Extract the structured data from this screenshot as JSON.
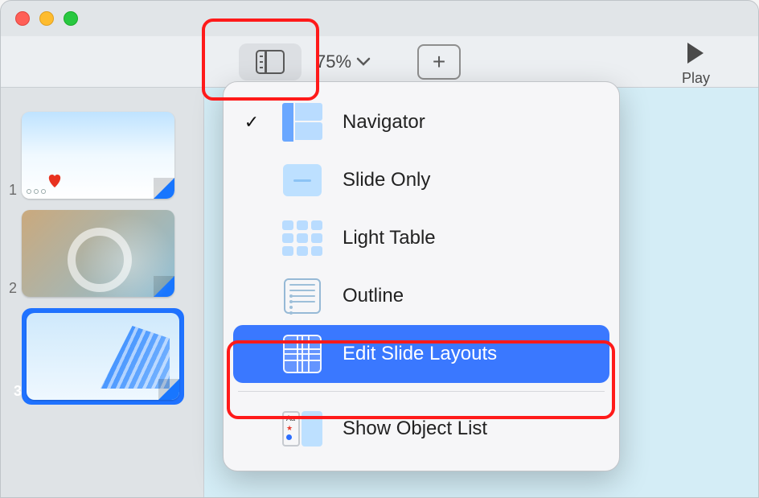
{
  "toolbar": {
    "zoom": "75%",
    "play_label": "Play"
  },
  "slides": [
    {
      "number": "1"
    },
    {
      "number": "2"
    },
    {
      "number": "3"
    }
  ],
  "selected_slide_index": 2,
  "view_menu": {
    "checked_index": 0,
    "highlighted_index": 4,
    "items": [
      {
        "label": "Navigator"
      },
      {
        "label": "Slide Only"
      },
      {
        "label": "Light Table"
      },
      {
        "label": "Outline"
      },
      {
        "label": "Edit Slide Layouts"
      },
      {
        "label": "Show Object List"
      }
    ]
  }
}
